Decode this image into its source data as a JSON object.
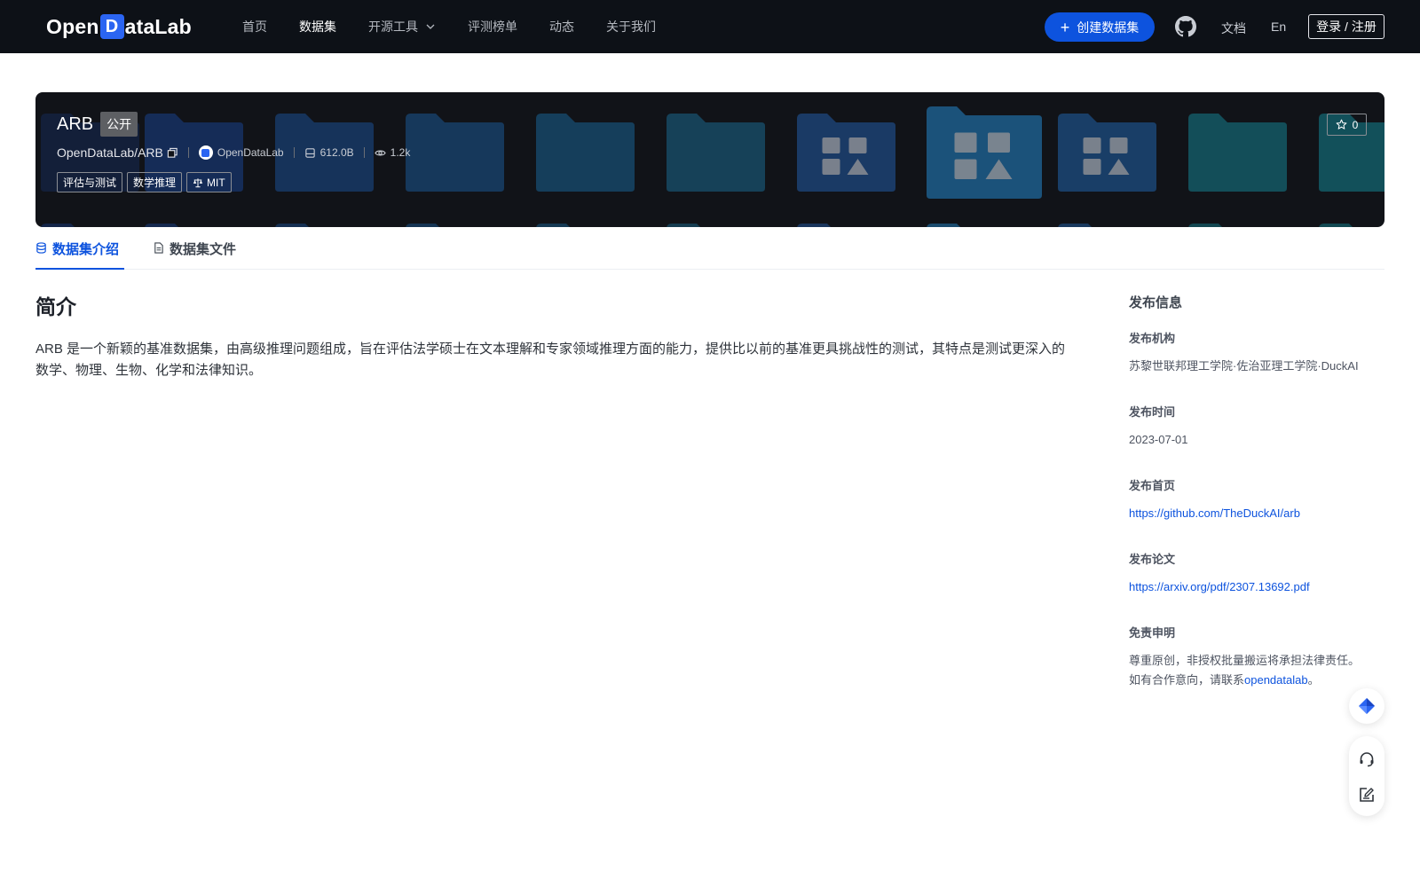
{
  "nav": {
    "logo_prefix": "Open",
    "logo_d": "D",
    "logo_suffix": "ataLab",
    "items": [
      {
        "label": "首页"
      },
      {
        "label": "数据集"
      },
      {
        "label": "开源工具"
      },
      {
        "label": "评测榜单"
      },
      {
        "label": "动态"
      },
      {
        "label": "关于我们"
      }
    ],
    "active_index": 1,
    "create_button": "创建数据集",
    "docs_link": "文档",
    "lang_link": "En",
    "login_button": "登录 / 注册"
  },
  "dataset": {
    "name": "ARB",
    "visibility": "公开",
    "path": "OpenDataLab/ARB",
    "org": "OpenDataLab",
    "size": "612.0B",
    "views": "1.2k",
    "tags": [
      "评估与测试",
      "数学推理"
    ],
    "license": "MIT",
    "stars": "0"
  },
  "tabs": [
    {
      "label": "数据集介绍"
    },
    {
      "label": "数据集文件"
    }
  ],
  "intro": {
    "title": "简介",
    "text": "ARB 是一个新颖的基准数据集，由高级推理问题组成，旨在评估法学硕士在文本理解和专家领域推理方面的能力，提供比以前的基准更具挑战性的测试，其特点是测试更深入的数学、物理、生物、化学和法律知识。"
  },
  "sidebar": {
    "title": "发布信息",
    "publisher_label": "发布机构",
    "publisher_value": "苏黎世联邦理工学院·佐治亚理工学院·DuckAI",
    "date_label": "发布时间",
    "date_value": "2023-07-01",
    "homepage_label": "发布首页",
    "homepage_value": "https://github.com/TheDuckAI/arb",
    "paper_label": "发布论文",
    "paper_value": "https://arxiv.org/pdf/2307.13692.pdf",
    "disclaimer_label": "免责申明",
    "disclaimer_line1": "尊重原创，非授权批量搬运将承担法律责任。",
    "disclaimer_line2": "如有合作意向，请联系",
    "disclaimer_contact": "opendatalab",
    "disclaimer_end": "。"
  },
  "colors": {
    "brand": "#0d53de",
    "nav_bg": "#0d1117",
    "banner_bg": "#111318"
  }
}
